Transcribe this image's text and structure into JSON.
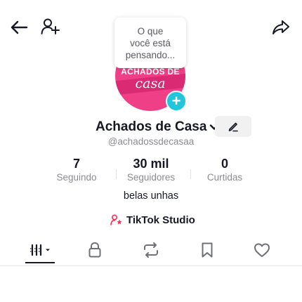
{
  "profile": {
    "note_bubble": "O que\nvocê está\npensando...",
    "avatar_text_top": "ACHADOS DE",
    "avatar_text_bottom": "casa",
    "display_name": "Achados de Casa",
    "username": "@achadossdecasaa",
    "bio": "belas unhas",
    "studio_link": "TikTok Studio"
  },
  "stats": [
    {
      "value": "7",
      "label": "Seguindo"
    },
    {
      "value": "30 mil",
      "label": "Seguidores"
    },
    {
      "value": "0",
      "label": "Curtidas"
    }
  ],
  "tabs": [
    {
      "icon": "grid-icon",
      "active": true
    },
    {
      "icon": "lock-icon",
      "active": false
    },
    {
      "icon": "repost-icon",
      "active": false
    },
    {
      "icon": "bookmark-icon",
      "active": false
    },
    {
      "icon": "heart-icon",
      "active": false
    }
  ],
  "colors": {
    "avatar": "#ef3f86",
    "plus_badge": "#20c6dc",
    "studio_icon": "#fe2c55",
    "text_primary": "#161823",
    "text_secondary": "#8a8b91"
  }
}
